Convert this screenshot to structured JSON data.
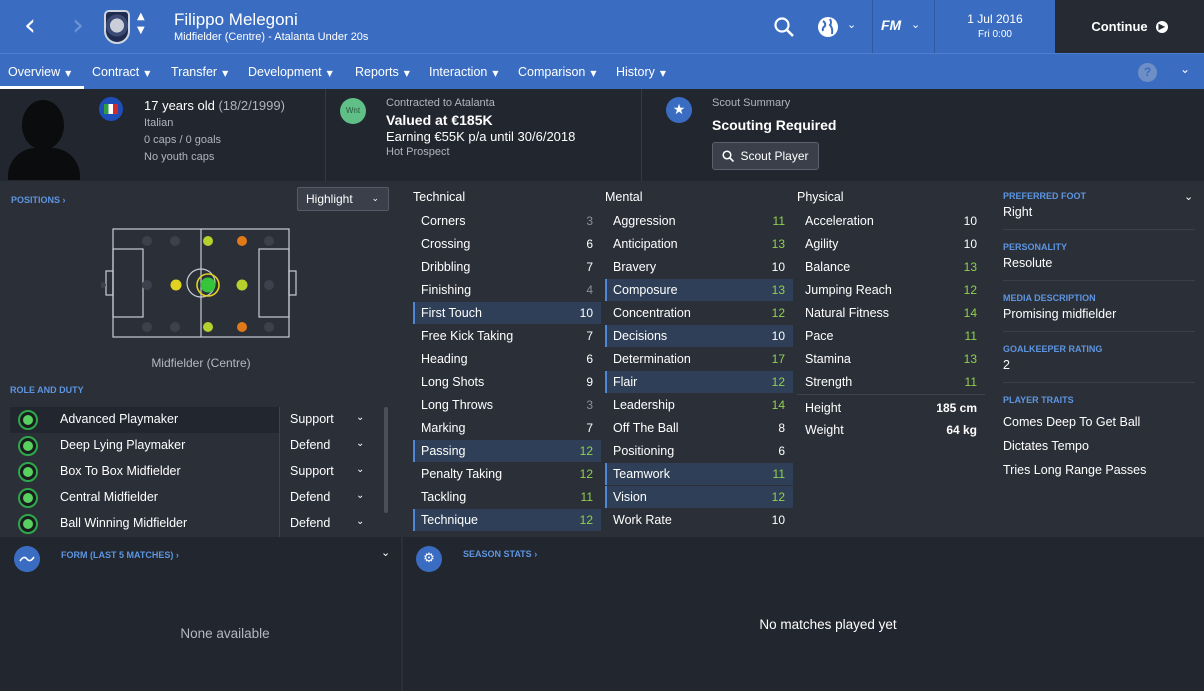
{
  "header": {
    "player_name": "Filippo Melegoni",
    "subtitle": "Midfielder (Centre) - Atalanta Under 20s",
    "date": "1 Jul 2016",
    "time": "Fri 0:00",
    "continue_label": "Continue",
    "fm_label": "FM"
  },
  "tabs": [
    {
      "label": "Overview"
    },
    {
      "label": "Contract"
    },
    {
      "label": "Transfer"
    },
    {
      "label": "Development"
    },
    {
      "label": "Reports"
    },
    {
      "label": "Interaction"
    },
    {
      "label": "Comparison"
    },
    {
      "label": "History"
    }
  ],
  "info": {
    "age": "17 years old",
    "dob": "(18/2/1999)",
    "nationality": "Italian",
    "caps": "0 caps / 0 goals",
    "youth_caps": "No youth caps",
    "contract_to": "Contracted to Atalanta",
    "valued": "Valued at €185K",
    "earning": "Earning €55K p/a until 30/6/2018",
    "hot_prospect": "Hot Prospect",
    "wnt_badge": "Wnt",
    "scout_summary_label": "Scout Summary",
    "scouting_status": "Scouting Required",
    "scout_button": "Scout Player"
  },
  "positions": {
    "label": "POSITIONS",
    "highlight_label": "Highlight",
    "position_name": "Midfielder (Centre)"
  },
  "roles": {
    "label": "ROLE AND DUTY",
    "items": [
      {
        "name": "Advanced Playmaker",
        "duty": "Support"
      },
      {
        "name": "Deep Lying Playmaker",
        "duty": "Defend"
      },
      {
        "name": "Box To Box Midfielder",
        "duty": "Support"
      },
      {
        "name": "Central Midfielder",
        "duty": "Defend"
      },
      {
        "name": "Ball Winning Midfielder",
        "duty": "Defend"
      }
    ]
  },
  "attributes": {
    "technical": {
      "title": "Technical",
      "items": [
        {
          "name": "Corners",
          "value": "3",
          "hl": false
        },
        {
          "name": "Crossing",
          "value": "6",
          "hl": false
        },
        {
          "name": "Dribbling",
          "value": "7",
          "hl": false
        },
        {
          "name": "Finishing",
          "value": "4",
          "hl": false
        },
        {
          "name": "First Touch",
          "value": "10",
          "hl": true
        },
        {
          "name": "Free Kick Taking",
          "value": "7",
          "hl": false
        },
        {
          "name": "Heading",
          "value": "6",
          "hl": false
        },
        {
          "name": "Long Shots",
          "value": "9",
          "hl": false
        },
        {
          "name": "Long Throws",
          "value": "3",
          "hl": false
        },
        {
          "name": "Marking",
          "value": "7",
          "hl": false
        },
        {
          "name": "Passing",
          "value": "12",
          "hl": true
        },
        {
          "name": "Penalty Taking",
          "value": "12",
          "hl": false
        },
        {
          "name": "Tackling",
          "value": "11",
          "hl": false
        },
        {
          "name": "Technique",
          "value": "12",
          "hl": true
        }
      ]
    },
    "mental": {
      "title": "Mental",
      "items": [
        {
          "name": "Aggression",
          "value": "11",
          "hl": false
        },
        {
          "name": "Anticipation",
          "value": "13",
          "hl": false
        },
        {
          "name": "Bravery",
          "value": "10",
          "hl": false
        },
        {
          "name": "Composure",
          "value": "13",
          "hl": true
        },
        {
          "name": "Concentration",
          "value": "12",
          "hl": false
        },
        {
          "name": "Decisions",
          "value": "10",
          "hl": true
        },
        {
          "name": "Determination",
          "value": "17",
          "hl": false
        },
        {
          "name": "Flair",
          "value": "12",
          "hl": true
        },
        {
          "name": "Leadership",
          "value": "14",
          "hl": false
        },
        {
          "name": "Off The Ball",
          "value": "8",
          "hl": false
        },
        {
          "name": "Positioning",
          "value": "6",
          "hl": false
        },
        {
          "name": "Teamwork",
          "value": "11",
          "hl": true
        },
        {
          "name": "Vision",
          "value": "12",
          "hl": true
        },
        {
          "name": "Work Rate",
          "value": "10",
          "hl": false
        }
      ]
    },
    "physical": {
      "title": "Physical",
      "items": [
        {
          "name": "Acceleration",
          "value": "10",
          "hl": false
        },
        {
          "name": "Agility",
          "value": "10",
          "hl": false
        },
        {
          "name": "Balance",
          "value": "13",
          "hl": false
        },
        {
          "name": "Jumping Reach",
          "value": "12",
          "hl": false
        },
        {
          "name": "Natural Fitness",
          "value": "14",
          "hl": false
        },
        {
          "name": "Pace",
          "value": "11",
          "hl": false
        },
        {
          "name": "Stamina",
          "value": "13",
          "hl": false
        },
        {
          "name": "Strength",
          "value": "11",
          "hl": false
        }
      ],
      "height_label": "Height",
      "height": "185 cm",
      "weight_label": "Weight",
      "weight": "64 kg"
    }
  },
  "details": {
    "preferred_foot_label": "PREFERRED FOOT",
    "preferred_foot": "Right",
    "personality_label": "PERSONALITY",
    "personality": "Resolute",
    "media_label": "MEDIA DESCRIPTION",
    "media": "Promising midfielder",
    "gk_label": "GOALKEEPER RATING",
    "gk_rating": "2",
    "traits_label": "PLAYER TRAITS",
    "traits": [
      "Comes Deep To Get Ball",
      "Dictates Tempo",
      "Tries Long Range Passes"
    ]
  },
  "form": {
    "label": "FORM (LAST 5 MATCHES)",
    "empty": "None available"
  },
  "season": {
    "label": "SEASON STATS",
    "empty": "No matches played yet"
  },
  "colors": {
    "accent": "#3a6dc2",
    "value_white": "#ffffff",
    "value_grey": "#8c9099",
    "value_green": "#8fd14f",
    "natural": "#36c53a",
    "accomplished": "#b6d12d",
    "competent": "#e0d21f",
    "unconvincing": "#e07a18"
  }
}
